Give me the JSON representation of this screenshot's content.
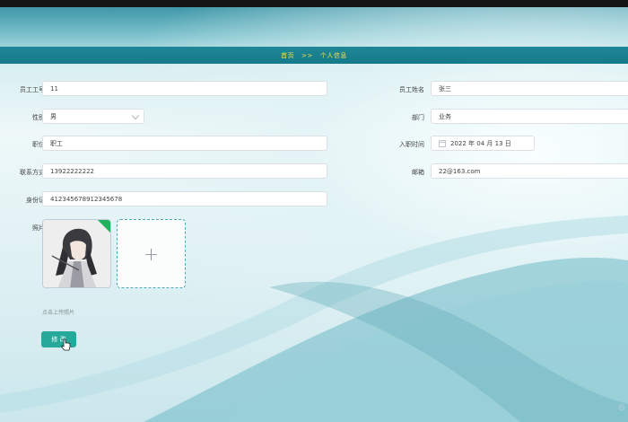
{
  "breadcrumb": {
    "home": "首页",
    "separator": ">>",
    "current": "个人信息"
  },
  "form": {
    "employee_id": {
      "label": "员工工号",
      "value": "11"
    },
    "employee_name": {
      "label": "员工姓名",
      "value": "张三"
    },
    "gender": {
      "label": "性别",
      "value": "男"
    },
    "department": {
      "label": "部门",
      "value": "业务"
    },
    "position": {
      "label": "职位",
      "value": "职工"
    },
    "hire_date": {
      "label": "入职时间",
      "value": "2022 年 04 月 13 日"
    },
    "contact": {
      "label": "联系方式",
      "value": "13922222222"
    },
    "email": {
      "label": "邮箱",
      "value": "22@163.com"
    },
    "id_card": {
      "label": "身份证",
      "value": "412345678912345678"
    },
    "photo": {
      "label": "照片",
      "upload_hint": "点击上传照片",
      "add_symbol": "+"
    }
  },
  "actions": {
    "submit_label": "修 改"
  },
  "colors": {
    "header": "#1a7f8f",
    "breadcrumb_text": "#f7e04a",
    "button": "#26a99b"
  }
}
